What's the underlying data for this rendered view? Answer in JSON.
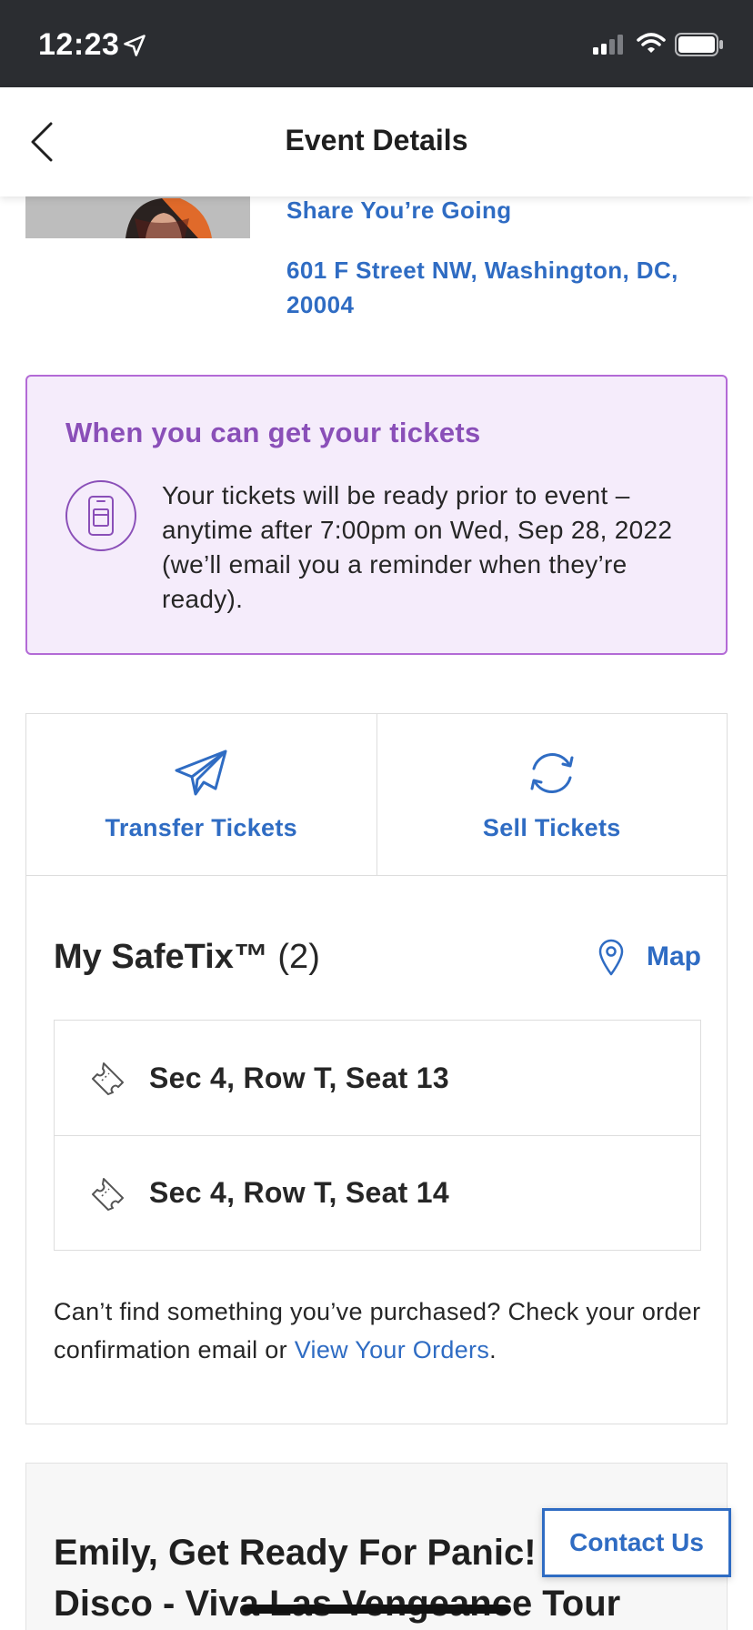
{
  "status_bar": {
    "time": "12:23"
  },
  "header": {
    "title": "Event Details",
    "back_icon": "chevron-left-icon"
  },
  "event": {
    "share_label": "Share You’re Going",
    "address": "601 F Street NW, Washington, DC, 20004"
  },
  "ticket_timing": {
    "title": "When you can get your tickets",
    "icon": "phone-ticket-icon",
    "text": "Your tickets will be ready prior to event – anytime after 7:00pm on Wed, Sep 28, 2022 (we’ll email you a reminder when they’re ready)."
  },
  "actions": {
    "transfer_label": "Transfer Tickets",
    "sell_label": "Sell Tickets"
  },
  "safetix": {
    "title": "My SafeTix™",
    "count": "(2)",
    "map_label": "Map",
    "seats": [
      {
        "label": "Sec 4, Row T, Seat 13"
      },
      {
        "label": "Sec 4, Row T, Seat 14"
      }
    ],
    "help_prefix": "Can’t find something you’ve purchased? Check your order confirmation email or ",
    "help_link": "View Your Orders",
    "help_suffix": "."
  },
  "promo": {
    "title": "Emily, Get Ready For Panic! At The Disco - Viva Las Vengeance Tour"
  },
  "contact": {
    "label": "Contact Us"
  },
  "colors": {
    "accent_blue": "#2f6cc3",
    "accent_purple": "#8a4fb8",
    "status_bar": "#2b2d31"
  }
}
